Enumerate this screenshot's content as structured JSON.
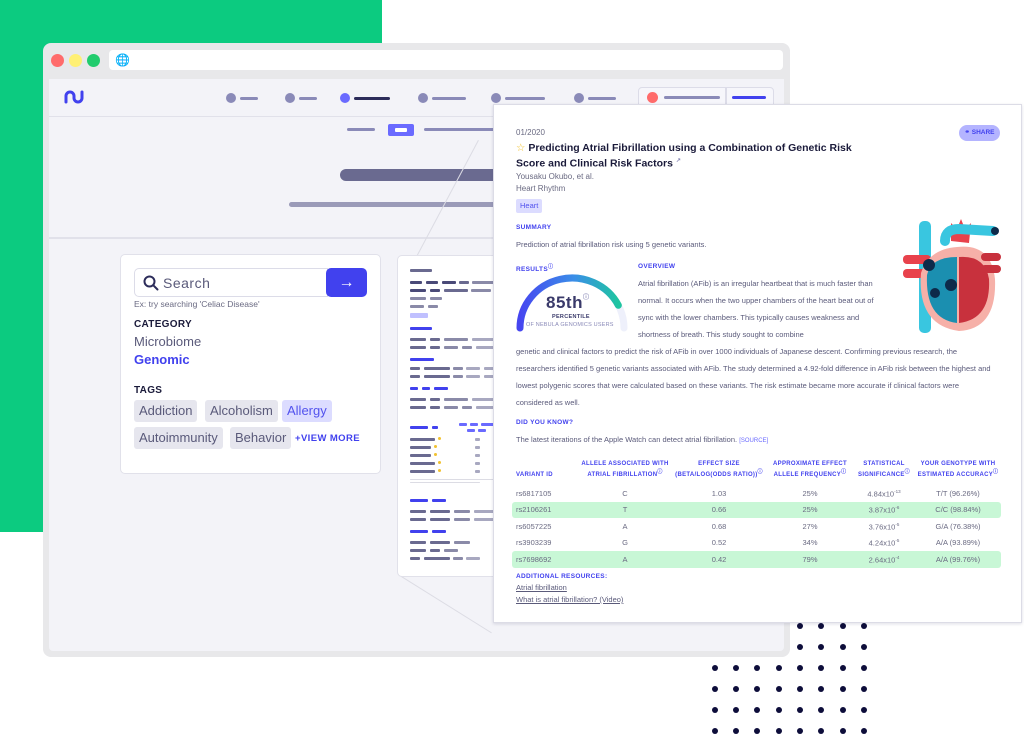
{
  "colors": {
    "brand_green": "#0ccb80",
    "accent_blue": "#4141ee",
    "highlight_row": "#c8f7d6",
    "dots": "#0d0d3a"
  },
  "browser": {
    "url": ""
  },
  "search_panel": {
    "placeholder": "Search",
    "submit_icon": "arrow-right-icon",
    "hint": "Ex: try searching 'Celiac Disease'",
    "category_label": "CATEGORY",
    "categories": [
      {
        "label": "Microbiome",
        "active": false
      },
      {
        "label": "Genomic",
        "active": true
      }
    ],
    "tags_label": "TAGS",
    "tags": [
      {
        "label": "Addiction",
        "active": false
      },
      {
        "label": "Alcoholism",
        "active": false
      },
      {
        "label": "Allergy",
        "active": true
      },
      {
        "label": "Autoimmunity",
        "active": false
      },
      {
        "label": "Behavior",
        "active": false
      }
    ],
    "view_more": "+VIEW MORE"
  },
  "report": {
    "date": "01/2020",
    "share_label": "SHARE",
    "title": "Predicting Atrial Fibrillation using a Combination of Genetic Risk Score and Clinical Risk Factors",
    "authors": "Yousaku Okubo, et al.",
    "journal": "Heart Rhythm",
    "tag": "Heart",
    "summary_heading": "SUMMARY",
    "summary": "Prediction of atrial fibrillation risk using 5 genetic variants.",
    "results_heading": "RESULTS",
    "result": {
      "percentile_value": 85,
      "percentile_label": "85th",
      "percentile_caption": "PERCENTILE",
      "population": "OF NEBULA GENOMICS USERS"
    },
    "overview_heading": "OVERVIEW",
    "overview_part1": "Atrial fibrillation (AFib) is an irregular heartbeat that is much faster than normal. It occurs when the two upper chambers of the heart beat out of sync with the lower chambers. This typically causes weakness and shortness of breath. This study sought to combine",
    "overview_part2": "genetic and clinical factors to predict the risk of AFib in over 1000 individuals of Japanese descent. Confirming previous research, the researchers identified 5 genetic variants associated with AFib. The study determined a 4.92-fold difference in AFib risk between the highest and lowest polygenic scores that were calculated based on these variants. The risk estimate became more accurate if clinical factors were considered as well.",
    "did_you_know_heading": "DID YOU KNOW?",
    "did_you_know": "The latest iterations of the Apple Watch can detect atrial fibrillation.",
    "source_label": "[SOURCE]",
    "table": {
      "headers": [
        "VARIANT ID",
        "ALLELE ASSOCIATED WITH ATRIAL FIBRILLATION",
        "EFFECT SIZE (BETA/LOG(ODDS RATIO))",
        "APPROXIMATE EFFECT ALLELE FREQUENCY",
        "STATISTICAL SIGNIFICANCE",
        "YOUR GENOTYPE WITH ESTIMATED ACCURACY"
      ],
      "rows": [
        {
          "variant": "rs6817105",
          "allele": "C",
          "effect": "1.03",
          "freq": "25%",
          "sig_base": "4.84x10",
          "sig_exp": "-13",
          "genotype": "T/T (96.26%)",
          "highlight": false
        },
        {
          "variant": "rs2106261",
          "allele": "T",
          "effect": "0.66",
          "freq": "25%",
          "sig_base": "3.87x10",
          "sig_exp": "-6",
          "genotype": "C/C (98.84%)",
          "highlight": true
        },
        {
          "variant": "rs6057225",
          "allele": "A",
          "effect": "0.68",
          "freq": "27%",
          "sig_base": "3.76x10",
          "sig_exp": "-5",
          "genotype": "G/A (76.38%)",
          "highlight": false
        },
        {
          "variant": "rs3903239",
          "allele": "G",
          "effect": "0.52",
          "freq": "34%",
          "sig_base": "4.24x10",
          "sig_exp": "-5",
          "genotype": "A/A (93.89%)",
          "highlight": false
        },
        {
          "variant": "rs7698692",
          "allele": "A",
          "effect": "0.42",
          "freq": "79%",
          "sig_base": "2.64x10",
          "sig_exp": "-4",
          "genotype": "A/A (99.76%)",
          "highlight": true
        }
      ]
    },
    "resources_heading": "ADDITIONAL RESOURCES:",
    "resources": [
      "Atrial fibrillation",
      "What is atrial fibrillation? (Video)"
    ]
  }
}
